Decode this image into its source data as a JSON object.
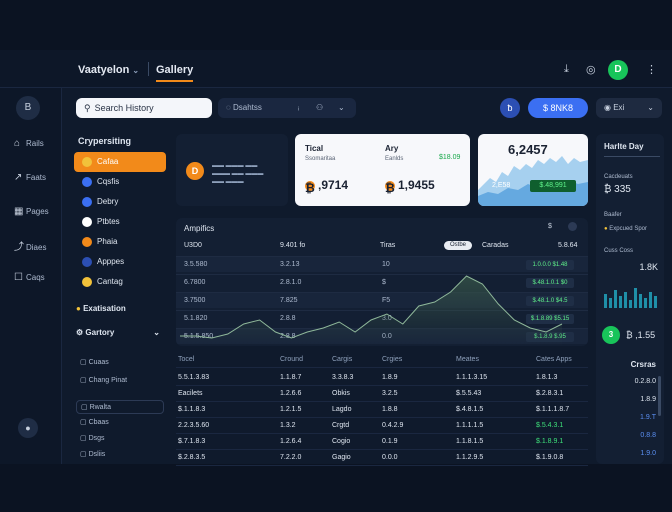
{
  "topbar": {
    "brand": "Vaatyelon",
    "tab": "Gallery",
    "icons": [
      "download-icon",
      "bell-icon"
    ],
    "avatar": "D"
  },
  "rail": {
    "logo": "B",
    "items": [
      {
        "icon": "⌂",
        "label": "Rails"
      },
      {
        "icon": "↗",
        "label": "Faats"
      },
      {
        "icon": "▦",
        "label": "Pages"
      },
      {
        "icon": "⤴",
        "label": "Diaes"
      },
      {
        "icon": "☐",
        "label": "Caqs"
      }
    ],
    "bottom": "●"
  },
  "search": {
    "placeholder": "Search History",
    "second": "Dsahtss",
    "blue_circle": "ƀ",
    "blue_btn": "$ 8NK8",
    "exit": "Exi"
  },
  "nav": {
    "heading": "Crypersiting",
    "items": [
      {
        "label": "Cafaa",
        "color": "#f2c23a",
        "active": true
      },
      {
        "label": "Cqsfis",
        "color": "#3b6ff2"
      },
      {
        "label": "Debry",
        "color": "#3b6ff2"
      },
      {
        "label": "Ptbtes",
        "color": "#ffffff"
      },
      {
        "label": "Phaia",
        "color": "#f28a1a"
      },
      {
        "label": "Apppes",
        "color": "#2c4fb3"
      },
      {
        "label": "Cantag",
        "color": "#f2c23a"
      }
    ],
    "sec1": "Exatisation",
    "sec2": "Gartory",
    "subs": [
      "Cuaas",
      "Chang Pinat",
      "Rwalta",
      "Cbaas",
      "Dsgs",
      "Dsliis"
    ]
  },
  "cards": {
    "dark_coin": "D",
    "white": {
      "l1": "Tical",
      "l1_sub": "Ssomaritaa",
      "l1_val": "‚9714",
      "l1_coin": "₿",
      "l2": "Ary",
      "l2_sub": "Eanlds",
      "l2_green": "$18.09",
      "l2_val": "1,9455",
      "l2_coin": "₿"
    },
    "chart": {
      "value": "6,2457",
      "sub": "2,E58",
      "pill": "$.48,991"
    }
  },
  "analytics": {
    "title": "Ampifics",
    "headers": [
      "U3D0",
      "9.401 fo",
      "Tiras",
      "Caradas",
      "Ostbe",
      "5.8.64"
    ],
    "rows": [
      {
        "a": "3.5.580",
        "b": "3.2.13",
        "c": "10",
        "tag": "1.0.0.0 $1.48"
      },
      {
        "a": "6.7800",
        "b": "2.8.1.0",
        "c": "$",
        "tag": "$.48.1.0.1 $0"
      },
      {
        "a": "3.7500",
        "b": "7.825",
        "c": "F5",
        "tag": "$.48.1.0 $4.5"
      },
      {
        "a": "5.1.820",
        "b": "2.8.8",
        "c": "3.0",
        "tag": "$.1.8.89 $5.15"
      },
      {
        "a": "5.1.5.850",
        "b": "2.8.8",
        "c": "0.0",
        "tag": "$.1.8.9 $.95"
      }
    ],
    "line": [
      30,
      30,
      31,
      29,
      24,
      22,
      28,
      31,
      28,
      26,
      23,
      28,
      22,
      19,
      24,
      15,
      13,
      8,
      0,
      4,
      14,
      22,
      26,
      28,
      24
    ]
  },
  "table": {
    "headers": [
      "Tocel",
      "Cround",
      "Cargis",
      "Crgies",
      "Meates",
      "Cates Apps"
    ],
    "rows": [
      [
        "5.5.1.3.83",
        "1.1.8.7",
        "3.3.8.3",
        "1.8.9",
        "1.1.1.3.15",
        "1.8.1.3"
      ],
      [
        "Eacilets",
        "1.2.6.6",
        "Obkis",
        "3.2.5",
        "$.5.5.43",
        "$.2.8.3.1"
      ],
      [
        "$.1.1.8.3",
        "1.2.1.5",
        "Lagdo",
        "1.8.8",
        "$.4.8.1.5",
        "$.1.1.1.8.7"
      ],
      [
        "2.2.3.5.60",
        "1.3.2",
        "Crgtd",
        "0.4.2.9",
        "1.1.1.1.5",
        "$.5.4.3.1"
      ],
      [
        "$.7.1.8.3",
        "1.2.6.4",
        "Cogio",
        "0.1.9",
        "1.1.8.1.5",
        "$.1.8.9.1"
      ],
      [
        "$.2.8.3.5",
        "7.2.2.0",
        "Gagio",
        "0.0.0",
        "1.1.2.9.5",
        "$.1.9.0.8"
      ]
    ]
  },
  "right": {
    "title": "Harlte Day",
    "sub1": "Cacdeuats",
    "val1": "₿ 335",
    "sub2": "Baafer",
    "sub2b": "Expcued Spor",
    "sub3": "Cuss Coss",
    "big": "1.8K",
    "green": "3",
    "green_val": "₿ ,1.55",
    "green_label": "Crsras",
    "list": [
      "0.2.8.0",
      "1.8.9",
      "1.9.T",
      "0.8.8",
      "1.9.0"
    ]
  }
}
